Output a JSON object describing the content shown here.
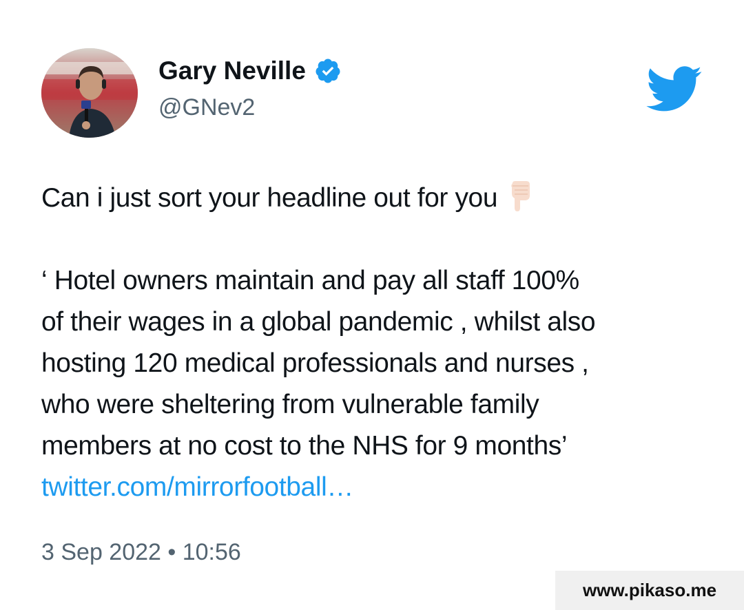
{
  "author": {
    "display_name": "Gary Neville",
    "handle": "@GNev2",
    "verified": true,
    "avatar_icon": "profile-photo"
  },
  "brand_icon": "twitter-bird-icon",
  "colors": {
    "twitter_blue": "#1d9bf0",
    "text": "#0f1419",
    "muted": "#536471"
  },
  "tweet": {
    "line1": "Can i just sort your headline out for you",
    "emoji_name": "backhand-index-pointing-down",
    "line2": "‘ Hotel owners maintain and pay all staff 100%",
    "line3": "of their wages in a global pandemic , whilst also",
    "line4": "hosting 120 medical professionals and nurses ,",
    "line5": "who were sheltering from vulnerable family",
    "line6": "members at no cost to the NHS for 9 months’",
    "link": "twitter.com/mirrorfootball…"
  },
  "timestamp": "3 Sep 2022 • 10:56",
  "watermark": "www.pikaso.me"
}
